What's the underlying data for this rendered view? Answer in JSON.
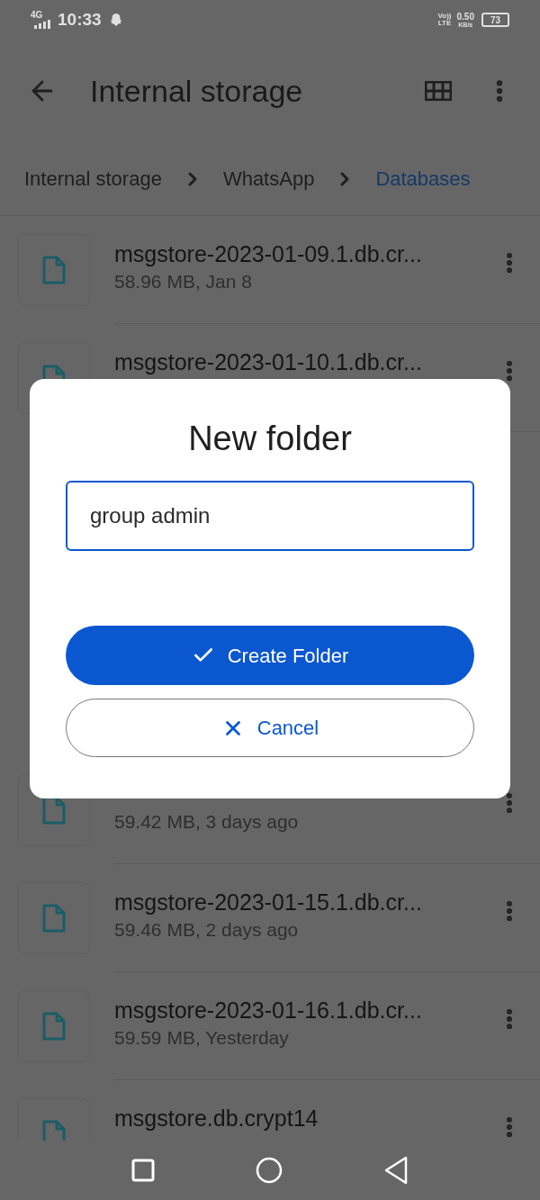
{
  "status_bar": {
    "network": "4G",
    "time": "10:33",
    "volte": "Vo))",
    "lte": "LTE",
    "speed": "0.50",
    "speed_unit": "KB/s",
    "battery": "73"
  },
  "toolbar": {
    "title": "Internal storage"
  },
  "breadcrumbs": [
    {
      "label": "Internal storage",
      "selected": false
    },
    {
      "label": "WhatsApp",
      "selected": false
    },
    {
      "label": "Databases",
      "selected": true
    }
  ],
  "files_above": [
    {
      "name": "msgstore-2023-01-09.1.db.cr...",
      "details": "58.96 MB, Jan 8"
    },
    {
      "name": "msgstore-2023-01-10.1.db.cr..."
    }
  ],
  "files_below": [
    {
      "details": "59.42 MB, 3 days ago"
    },
    {
      "name": "msgstore-2023-01-15.1.db.cr...",
      "details": "59.46 MB, 2 days ago"
    },
    {
      "name": "msgstore-2023-01-16.1.db.cr...",
      "details": "59.59 MB, Yesterday"
    },
    {
      "name": "msgstore.db.crypt14"
    }
  ],
  "dialog": {
    "title": "New folder",
    "input": {
      "value": "group admin"
    },
    "buttons": [
      {
        "label": "Create Folder",
        "kind": "primary"
      },
      {
        "label": "Cancel",
        "kind": "secondary"
      }
    ]
  }
}
